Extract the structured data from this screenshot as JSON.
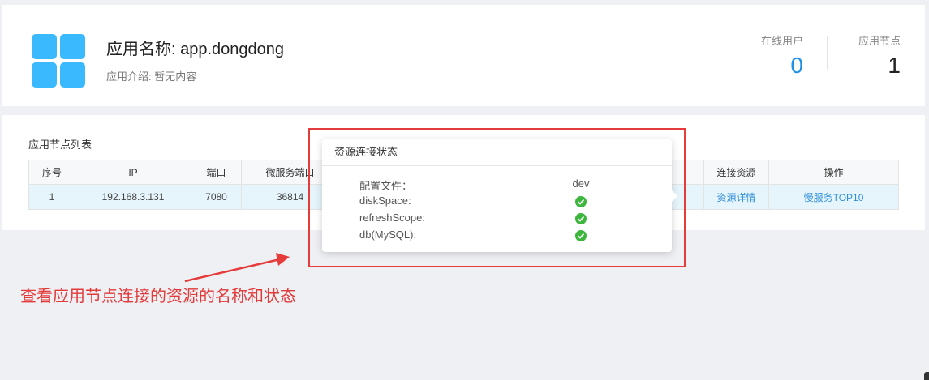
{
  "header": {
    "app_name_label": "应用名称: app.dongdong",
    "app_desc_label": "应用介绍: 暂无内容",
    "stats": {
      "online_users_label": "在线用户",
      "online_users_value": "0",
      "nodes_label": "应用节点",
      "nodes_value": "1"
    },
    "logo_color": "#3bb9ff"
  },
  "node_list": {
    "title": "应用节点列表",
    "columns": [
      "序号",
      "IP",
      "端口",
      "微服务端口",
      "连接资源",
      "操作"
    ],
    "rows": [
      {
        "index": "1",
        "ip": "192.168.3.131",
        "port": "7080",
        "ms_port": "36814",
        "resource_link": "资源详情",
        "action_link": "慢服务TOP10"
      }
    ]
  },
  "popover": {
    "title": "资源连接状态",
    "items": [
      {
        "name": "配置文件：",
        "value": "dev",
        "kind": "text"
      },
      {
        "name": "diskSpace:",
        "value": "ok",
        "kind": "check-icon"
      },
      {
        "name": "refreshScope:",
        "value": "ok",
        "kind": "check-icon"
      },
      {
        "name": "db(MySQL):",
        "value": "ok",
        "kind": "check-icon"
      }
    ]
  },
  "annotation": {
    "text": "查看应用节点连接的资源的名称和状态",
    "color": "#e53b3b"
  }
}
